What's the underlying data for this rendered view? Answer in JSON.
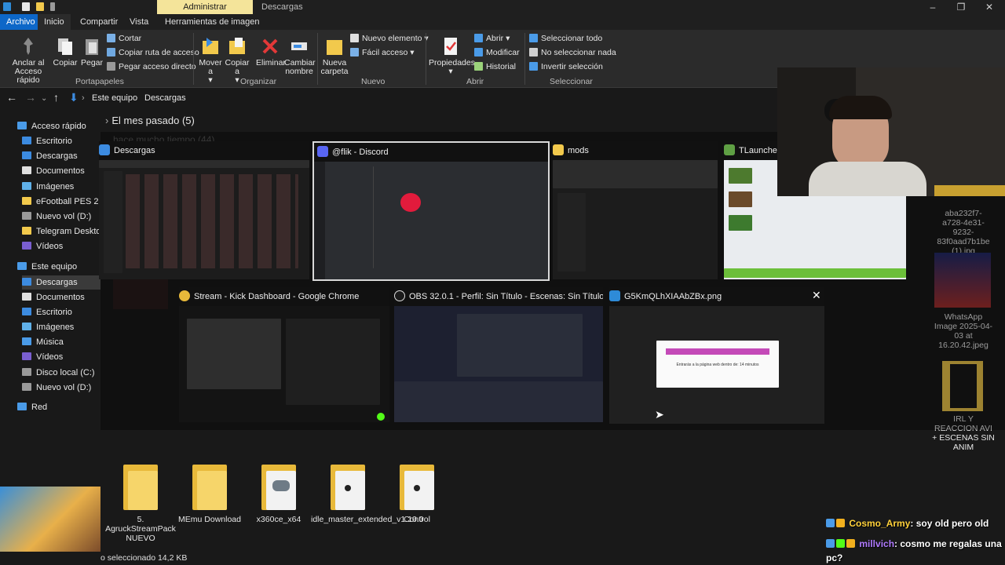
{
  "titlebar": {
    "context_tab": "Administrar",
    "title": "Descargas"
  },
  "ribbon_tabs": [
    "Archivo",
    "Inicio",
    "Compartir",
    "Vista",
    "Herramientas de imagen"
  ],
  "ribbon": {
    "anclar": "Anclar al Acceso rápido",
    "copiar": "Copiar",
    "pegar": "Pegar",
    "cortar": "Cortar",
    "copiar_ruta": "Copiar ruta de acceso",
    "pegar_acceso": "Pegar acceso directo",
    "portapapeles": "Portapapeles",
    "mover": "Mover a",
    "copiar_a": "Copiar a",
    "eliminar": "Eliminar",
    "cambiar_nombre": "Cambiar nombre",
    "organizar": "Organizar",
    "nueva_carpeta": "Nueva carpeta",
    "nuevo_elemento": "Nuevo elemento",
    "facil_acceso": "Fácil acceso",
    "nuevo": "Nuevo",
    "propiedades": "Propiedades",
    "abrir": "Abrir",
    "modificar": "Modificar",
    "historial": "Historial",
    "abrir_grp": "Abrir",
    "seleccionar_todo": "Seleccionar todo",
    "no_seleccionar": "No seleccionar nada",
    "invertir": "Invertir selección",
    "seleccionar": "Seleccionar"
  },
  "address": {
    "crumbs": [
      "Este equipo",
      "Descargas"
    ]
  },
  "nav": {
    "items": [
      "Acceso rápido",
      "Escritorio",
      "Descargas",
      "Documentos",
      "Imágenes",
      "eFootball PES 2021",
      "Nuevo vol (D:)",
      "Telegram Desktop",
      "Vídeos",
      "Este equipo",
      "Descargas",
      "Documentos",
      "Escritorio",
      "Imágenes",
      "Música",
      "Vídeos",
      "Disco local (C:)",
      "Nuevo vol (D:)",
      "Red"
    ]
  },
  "section": {
    "header": "El mes pasado (5)",
    "older": "hace mucho tiempo (44)"
  },
  "taskview": {
    "windows": [
      {
        "title": "Descargas"
      },
      {
        "title": "@flik - Discord"
      },
      {
        "title": "mods"
      },
      {
        "title": "TLauncher"
      },
      {
        "title": "Stream - Kick Dashboard - Google Chrome"
      },
      {
        "title": "OBS 32.0.1 - Perfil: Sin Título - Escenas: Sin Título"
      },
      {
        "title": "G5KmQLhXIAAbZBx.png"
      }
    ],
    "popup_text": "Entrarás a la página web dentro de: 14 minutos"
  },
  "files": {
    "folders": [
      "5. AgruckStreamPack NUEVO",
      "MEmu Download",
      "x360ce_x64",
      "idle_master_extended_v1.10.0",
      "Control"
    ],
    "right": [
      "aba232f7-a728-4e31-9232-83f0aad7b1be (1).jpg",
      "WhatsApp Image 2025-04-03 at 16.20.42.jpeg",
      "IRL Y REACCION AVI + ESCENAS SIN ANIM"
    ]
  },
  "status": {
    "text": "o seleccionado  14,2 KB"
  },
  "chat": [
    {
      "user": "Cosmo_Army",
      "msg": ": soy old pero old"
    },
    {
      "user": "millvich",
      "msg": ": cosmo me regalas una pc?"
    }
  ],
  "colors": {
    "accent": "#0d67c8",
    "context": "#f4e49a",
    "folder": "#f6d56a"
  }
}
